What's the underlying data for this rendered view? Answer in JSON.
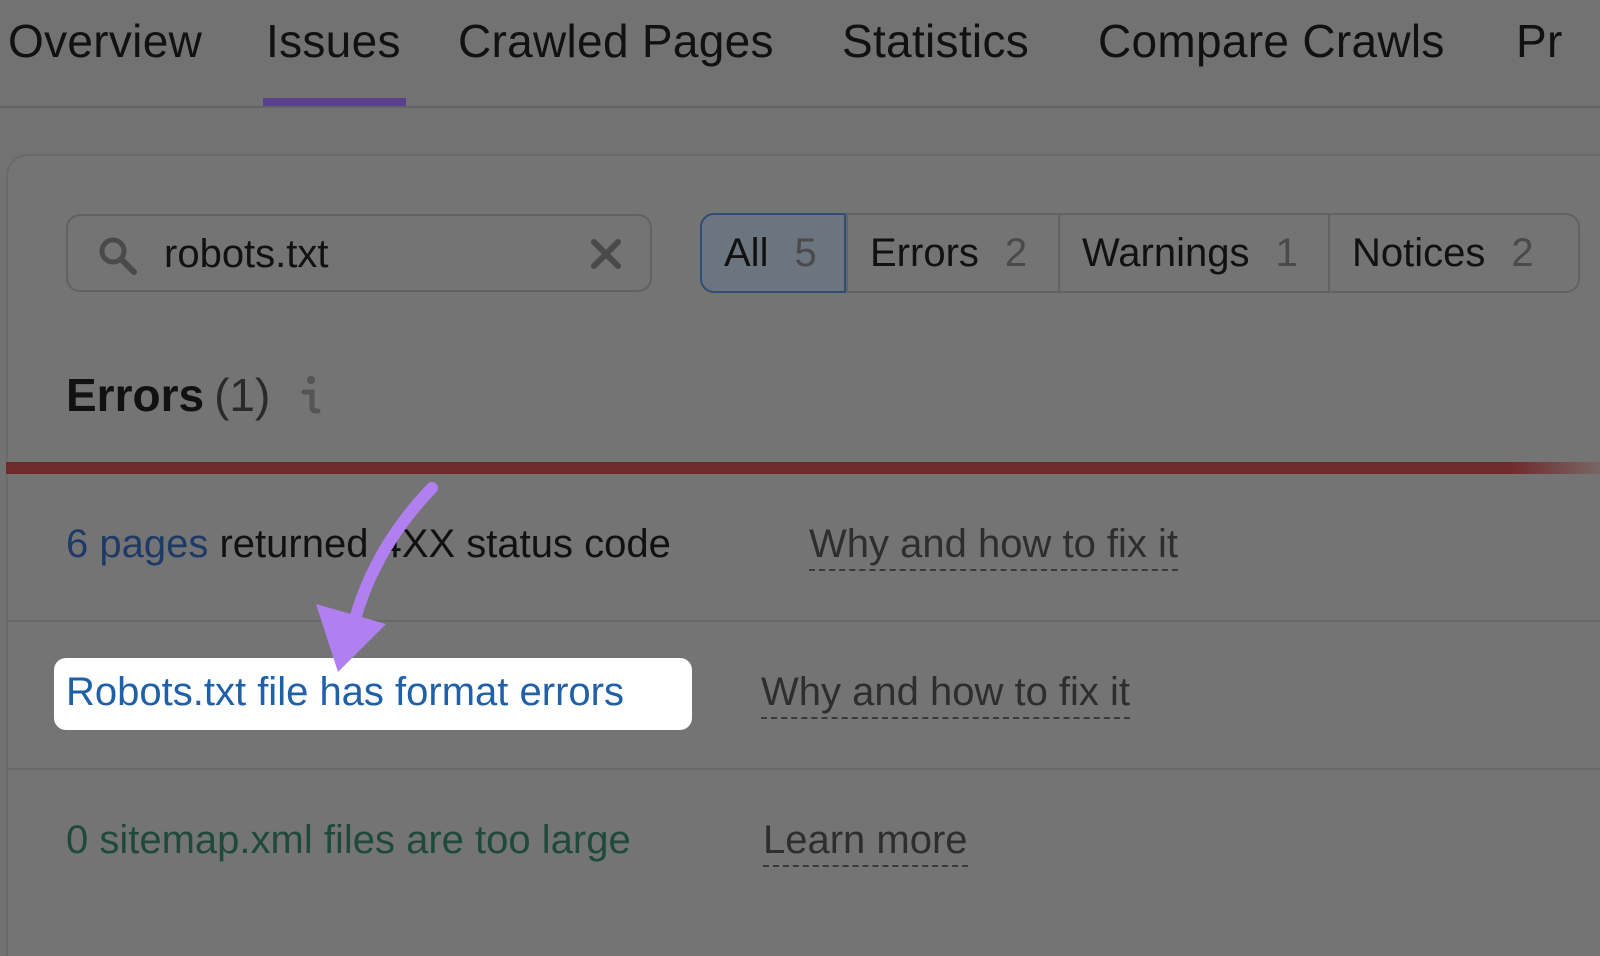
{
  "tabs": [
    {
      "label": "Overview",
      "active": false
    },
    {
      "label": "Issues",
      "active": true
    },
    {
      "label": "Crawled Pages",
      "active": false
    },
    {
      "label": "Statistics",
      "active": false
    },
    {
      "label": "Compare Crawls",
      "active": false
    },
    {
      "label": "Pr",
      "active": false
    }
  ],
  "search": {
    "value": "robots.txt",
    "icon": "search-icon",
    "clear_icon": "close-icon"
  },
  "filters": [
    {
      "label": "All",
      "count": "5",
      "active": true
    },
    {
      "label": "Errors",
      "count": "2",
      "active": false
    },
    {
      "label": "Warnings",
      "count": "1",
      "active": false
    },
    {
      "label": "Notices",
      "count": "2",
      "active": false
    }
  ],
  "errors_section": {
    "title": "Errors",
    "count": "(1)",
    "info_icon": "info-icon"
  },
  "issues": [
    {
      "link": "6 pages",
      "text": " returned 4XX status code",
      "action": "Why and how to fix it"
    },
    {
      "link": "Robots.txt file has format errors",
      "text": "",
      "action": "Why and how to fix it",
      "highlighted": true
    },
    {
      "link": "0 sitemap.xml files are too large",
      "text": "",
      "action": "Learn more"
    }
  ],
  "colors": {
    "accent_tab": "#5a3f8e",
    "error_bar": "#6f2a2c",
    "link": "#1e3a66",
    "highlight_link": "#2060a8",
    "annotation_arrow": "#b07ff0",
    "zero_issue": "#1f4a3a"
  }
}
